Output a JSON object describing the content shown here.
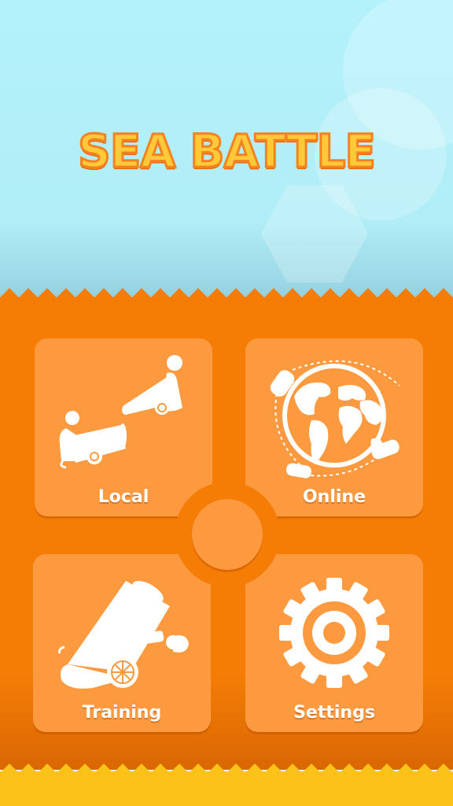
{
  "game": {
    "title": "SEA BATTLE"
  },
  "menu": {
    "local": {
      "label": "Local",
      "icon": "two-cannons-icon"
    },
    "online": {
      "label": "Online",
      "icon": "globe-icon"
    },
    "training": {
      "label": "Training",
      "icon": "cannon-icon"
    },
    "settings": {
      "label": "Settings",
      "icon": "gear-icon"
    }
  },
  "colors": {
    "sky": "#b4f2fb",
    "panel": "#f57d06",
    "tile": "#fd9a3f",
    "title_fill": "#ffc93a",
    "title_outline": "#f5821f",
    "bottom_strip": "#fbc21a"
  }
}
